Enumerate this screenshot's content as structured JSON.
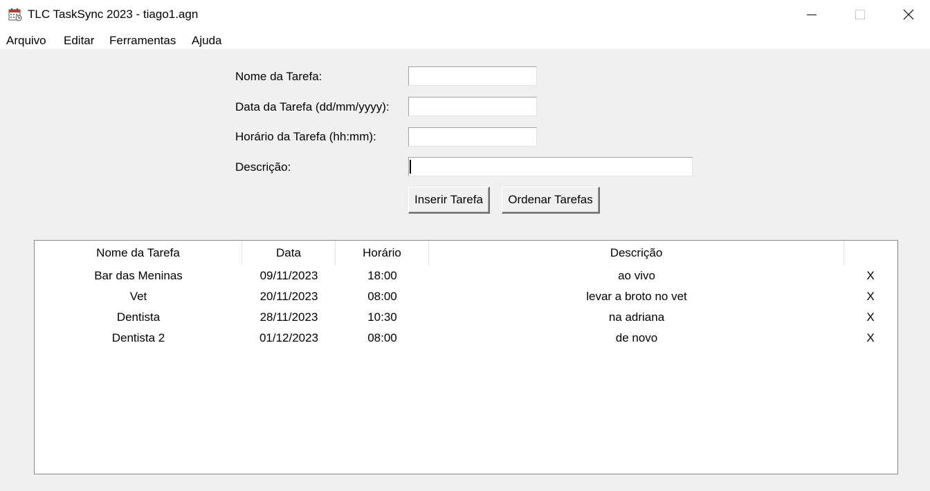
{
  "window": {
    "title": "TLC TaskSync 2023 - tiago1.agn",
    "app_icon": "calendar-icon",
    "controls": [
      "minimize-icon",
      "maximize-icon",
      "close-icon"
    ]
  },
  "menubar": {
    "items": [
      "Arquivo",
      "Editar",
      "Ferramentas",
      "Ajuda"
    ]
  },
  "form": {
    "name_label": "Nome da Tarefa:",
    "date_label": "Data da Tarefa (dd/mm/yyyy):",
    "time_label": "Horário da Tarefa (hh:mm):",
    "desc_label": "Descrição:",
    "name_value": "",
    "date_value": "",
    "time_value": "",
    "desc_value": "",
    "insert_button": "Inserir Tarefa",
    "order_button": "Ordenar Tarefas"
  },
  "table": {
    "columns": [
      "Nome da Tarefa",
      "Data",
      "Horário",
      "Descrição",
      ""
    ],
    "rows": [
      {
        "name": "Bar das Meninas",
        "date": "09/11/2023",
        "time": "18:00",
        "desc": "ao vivo",
        "delete": "X"
      },
      {
        "name": "Vet",
        "date": "20/11/2023",
        "time": "08:00",
        "desc": "levar a broto no vet",
        "delete": "X"
      },
      {
        "name": "Dentista",
        "date": "28/11/2023",
        "time": "10:30",
        "desc": "na adriana",
        "delete": "X"
      },
      {
        "name": "Dentista 2",
        "date": "01/12/2023",
        "time": "08:00",
        "desc": "de novo",
        "delete": "X"
      }
    ]
  }
}
